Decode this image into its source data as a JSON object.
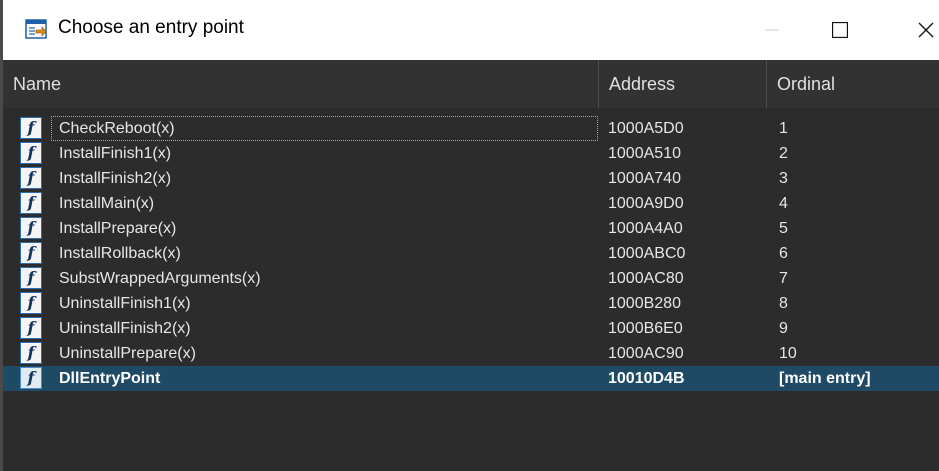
{
  "window": {
    "title": "Choose an entry point",
    "title_icon": "entry-point-icon"
  },
  "header": {
    "name": "Name",
    "address": "Address",
    "ordinal": "Ordinal"
  },
  "rows": [
    {
      "name": "CheckReboot(x)",
      "address": "1000A5D0",
      "ordinal": "1"
    },
    {
      "name": "InstallFinish1(x)",
      "address": "1000A510",
      "ordinal": "2"
    },
    {
      "name": "InstallFinish2(x)",
      "address": "1000A740",
      "ordinal": "3"
    },
    {
      "name": "InstallMain(x)",
      "address": "1000A9D0",
      "ordinal": "4"
    },
    {
      "name": "InstallPrepare(x)",
      "address": "1000A4A0",
      "ordinal": "5"
    },
    {
      "name": "InstallRollback(x)",
      "address": "1000ABC0",
      "ordinal": "6"
    },
    {
      "name": "SubstWrappedArguments(x)",
      "address": "1000AC80",
      "ordinal": "7"
    },
    {
      "name": "UninstallFinish1(x)",
      "address": "1000B280",
      "ordinal": "8"
    },
    {
      "name": "UninstallFinish2(x)",
      "address": "1000B6E0",
      "ordinal": "9"
    },
    {
      "name": "UninstallPrepare(x)",
      "address": "1000AC90",
      "ordinal": "10"
    },
    {
      "name": "DllEntryPoint",
      "address": "10010D4B",
      "ordinal": "[main entry]"
    }
  ],
  "icons": {
    "row_icon": "function-icon",
    "glyph": "f"
  },
  "colors": {
    "list_background": "#2c2c2c",
    "header_background": "#323232",
    "selected_row": "#1f4a66",
    "text": "#e6e6e6"
  }
}
